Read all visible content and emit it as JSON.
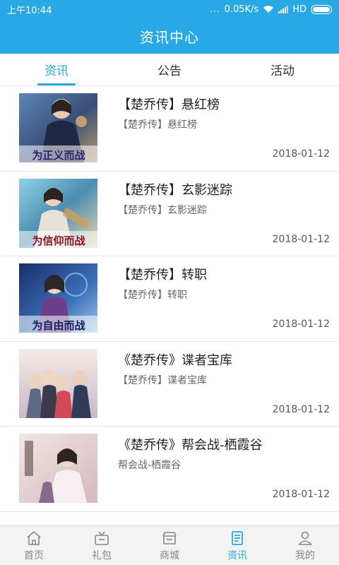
{
  "status_bar": {
    "time": "上午10:44",
    "dots": "...",
    "speed": "0.05K/s",
    "network": "HD"
  },
  "header": {
    "title": "资讯中心"
  },
  "tabs": [
    {
      "label": "资讯",
      "active": true
    },
    {
      "label": "公告",
      "active": false
    },
    {
      "label": "活动",
      "active": false
    }
  ],
  "items": [
    {
      "title": "【楚乔传】悬红榜",
      "subtitle": "【楚乔传】悬红榜",
      "date": "2018-01-12",
      "banner_text": "为正义而战"
    },
    {
      "title": "【楚乔传】玄影迷踪",
      "subtitle": "【楚乔传】玄影迷踪",
      "date": "2018-01-12",
      "banner_text": "为信仰而战"
    },
    {
      "title": "【楚乔传】转职",
      "subtitle": "【楚乔传】转职",
      "date": "2018-01-12",
      "banner_text": "为自由而战"
    },
    {
      "title": "《楚乔传》谍者宝库",
      "subtitle": "【楚乔传】谍者宝库",
      "date": "2018-01-12",
      "banner_text": ""
    },
    {
      "title": "《楚乔传》帮会战-栖霞谷",
      "subtitle": "帮会战-栖霞谷",
      "date": "2018-01-12",
      "banner_text": ""
    }
  ],
  "bottom_nav": [
    {
      "label": "首页",
      "icon": "home-icon",
      "active": false
    },
    {
      "label": "礼包",
      "icon": "gift-tv-icon",
      "active": false
    },
    {
      "label": "商城",
      "icon": "shop-icon",
      "active": false
    },
    {
      "label": "资讯",
      "icon": "news-icon",
      "active": true
    },
    {
      "label": "我的",
      "icon": "profile-icon",
      "active": false
    }
  ],
  "colors": {
    "accent": "#28a9e6",
    "inactive": "#888888"
  }
}
